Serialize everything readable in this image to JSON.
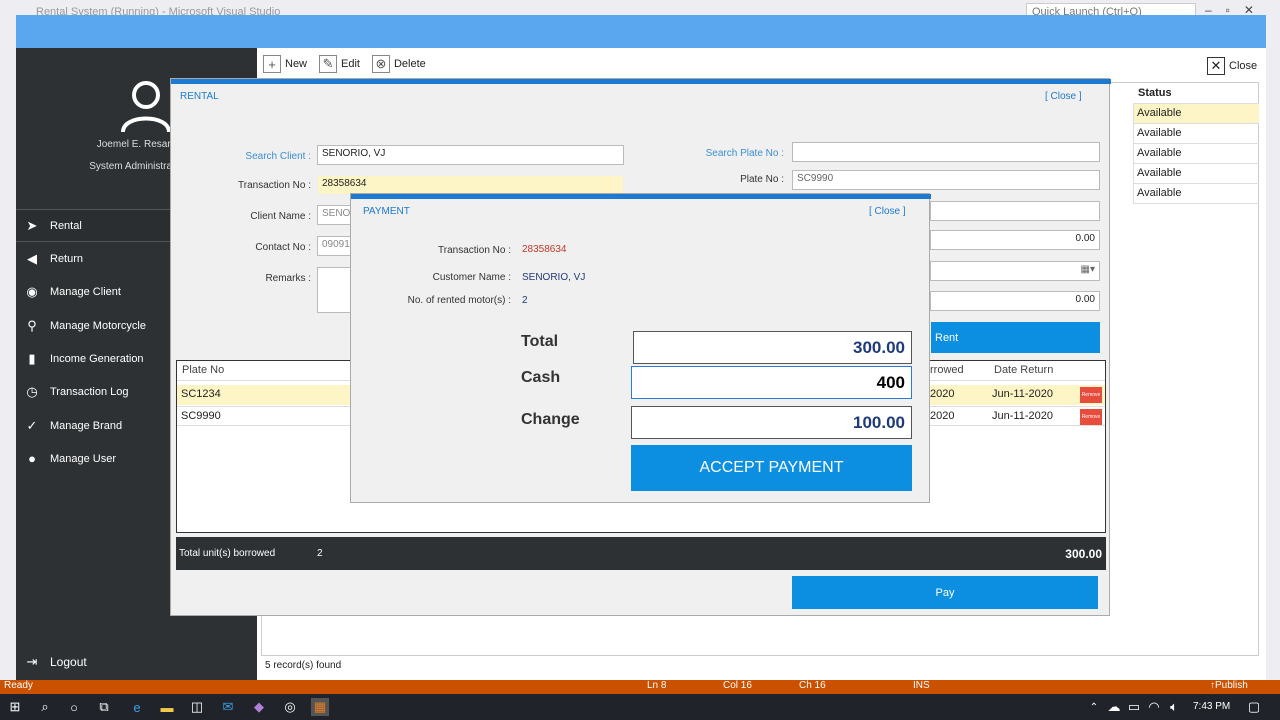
{
  "vs": {
    "title": "Rental System (Running) - Microsoft Visual Studio",
    "quick_launch": "Quick Launch (Ctrl+Q)",
    "status": {
      "ready": "Ready",
      "ln": "Ln 8",
      "col": "Col 16",
      "ch": "Ch 16",
      "ins": "INS",
      "publish": "Publish"
    }
  },
  "sidebar": {
    "user_name": "Joemel E. Resare",
    "user_role": "System Administrator",
    "items": [
      {
        "label": "Rental",
        "icon": "arrow-right-icon"
      },
      {
        "label": "Return",
        "icon": "arrow-left-icon"
      },
      {
        "label": "Manage Client",
        "icon": "client-icon"
      },
      {
        "label": "Manage Motorcycle",
        "icon": "motorcycle-icon"
      },
      {
        "label": "Income Generation",
        "icon": "chart-icon"
      },
      {
        "label": "Transaction Log",
        "icon": "history-icon"
      },
      {
        "label": "Manage Brand",
        "icon": "check-circle-icon"
      },
      {
        "label": "Manage User",
        "icon": "user-icon"
      }
    ],
    "logout": "Logout"
  },
  "toolbar": {
    "new": "New",
    "edit": "Edit",
    "delete": "Delete",
    "close": "Close"
  },
  "grid": {
    "status_header": "Status",
    "statuses": [
      "Available",
      "Available",
      "Available",
      "Available",
      "Available"
    ],
    "records": "5  record(s) found"
  },
  "rental": {
    "title": "RENTAL",
    "close": "[ Close ]",
    "search_client_label": "Search Client :",
    "search_client_value": "SENORIO, VJ",
    "transaction_label": "Transaction No :",
    "transaction_value": "28358634",
    "client_name_label": "Client Name :",
    "client_name_value": "SENOR",
    "contact_label": "Contact No :",
    "contact_value": "090912",
    "remarks_label": "Remarks :",
    "search_plate_label": "Search Plate No :",
    "search_plate_value": "",
    "plate_label": "Plate No :",
    "plate_value": "SC9990",
    "amount1": "0.00",
    "amount2": "0.00",
    "rent_button": "Rent",
    "grid_headers": {
      "plate": "Plate No",
      "borrowed": "rrowed",
      "return": "Date Return"
    },
    "grid_rows": [
      {
        "plate": "SC1234",
        "borrowed": "2020",
        "return": "Jun-11-2020"
      },
      {
        "plate": "SC9990",
        "borrowed": "2020",
        "return": "Jun-11-2020"
      }
    ],
    "remove_label": "Remove",
    "summary_label": "Total unit(s) borrowed",
    "summary_count": "2",
    "summary_total": "300.00",
    "pay_button": "Pay"
  },
  "payment": {
    "title": "PAYMENT",
    "close": "[ Close ]",
    "transaction_label": "Transaction No :",
    "transaction_value": "28358634",
    "customer_label": "Customer Name :",
    "customer_value": "SENORIO, VJ",
    "rented_label": "No. of rented motor(s) :",
    "rented_value": "2",
    "total_label": "Total",
    "total_value": "300.00",
    "cash_label": "Cash",
    "cash_value": "400",
    "change_label": "Change",
    "change_value": "100.00",
    "accept_button": "ACCEPT PAYMENT"
  },
  "taskbar": {
    "clock": "7:43 PM"
  }
}
